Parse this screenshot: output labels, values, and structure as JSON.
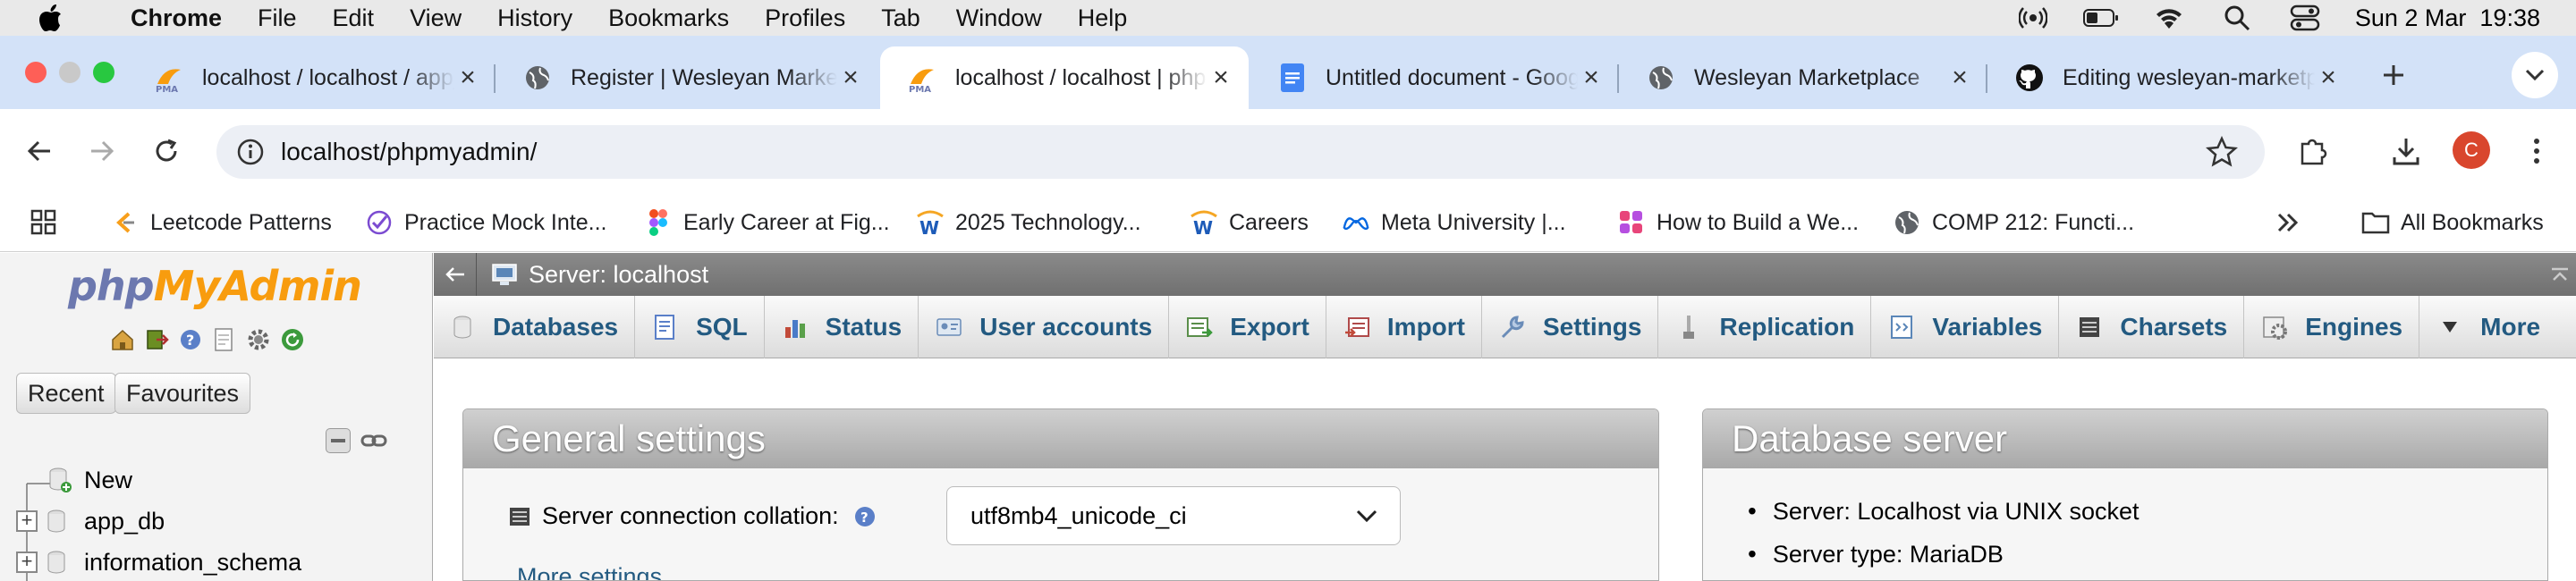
{
  "menubar": {
    "app_name": "Chrome",
    "items": [
      "File",
      "Edit",
      "View",
      "History",
      "Bookmarks",
      "Profiles",
      "Tab",
      "Window",
      "Help"
    ],
    "datetime": "Sun 2 Mar  19:38"
  },
  "tabs": [
    {
      "label": "localhost / localhost / app_db",
      "favicon": "pma-icon"
    },
    {
      "label": "Register | Wesleyan Marketplace",
      "favicon": "globe-icon"
    },
    {
      "label": "localhost / localhost | phpMyAdmin",
      "favicon": "pma-icon",
      "active": true
    },
    {
      "label": "Untitled document - Google Docs",
      "favicon": "docs-icon"
    },
    {
      "label": "Wesleyan Marketplace",
      "favicon": "globe-icon"
    },
    {
      "label": "Editing wesleyan-marketplace",
      "favicon": "github-icon"
    }
  ],
  "address": {
    "url": "localhost/phpmyadmin/"
  },
  "profile_initial": "C",
  "bookmarks": {
    "items": [
      {
        "label": "Leetcode Patterns",
        "icon": "leetcode-icon"
      },
      {
        "label": "Practice Mock Inte...",
        "icon": "check-icon"
      },
      {
        "label": "Early Career at Fig...",
        "icon": "figma-icon"
      },
      {
        "label": "2025 Technology...",
        "icon": "w-icon"
      },
      {
        "label": "Careers",
        "icon": "w-icon"
      },
      {
        "label": "Meta University |...",
        "icon": "meta-icon"
      },
      {
        "label": "How to Build a We...",
        "icon": "bookmark-icon"
      },
      {
        "label": "COMP 212: Functi...",
        "icon": "globe-icon"
      }
    ],
    "all_label": "All Bookmarks"
  },
  "pma_left": {
    "logo_php": "php",
    "logo_myadmin": "MyAdmin",
    "recent_label": "Recent",
    "favourites_label": "Favourites",
    "tree": [
      {
        "label": "New"
      },
      {
        "label": "app_db"
      },
      {
        "label": "information_schema"
      }
    ]
  },
  "pma_main": {
    "server_title": "Server: localhost",
    "nav_tabs": [
      "Databases",
      "SQL",
      "Status",
      "User accounts",
      "Export",
      "Import",
      "Settings",
      "Replication",
      "Variables",
      "Charsets",
      "Engines",
      "More"
    ],
    "general_settings": {
      "title": "General settings",
      "collation_label": "Server connection collation:",
      "collation_value": "utf8mb4_unicode_ci",
      "more_settings": "More settings"
    },
    "database_server": {
      "title": "Database server",
      "items": [
        "Server: Localhost via UNIX socket",
        "Server type: MariaDB"
      ]
    }
  },
  "colors": {
    "tabstrip": "#d3e2f8",
    "pma_link": "#235a81",
    "pma_orange": "#f89c0e",
    "pma_blue": "#6c78af"
  }
}
